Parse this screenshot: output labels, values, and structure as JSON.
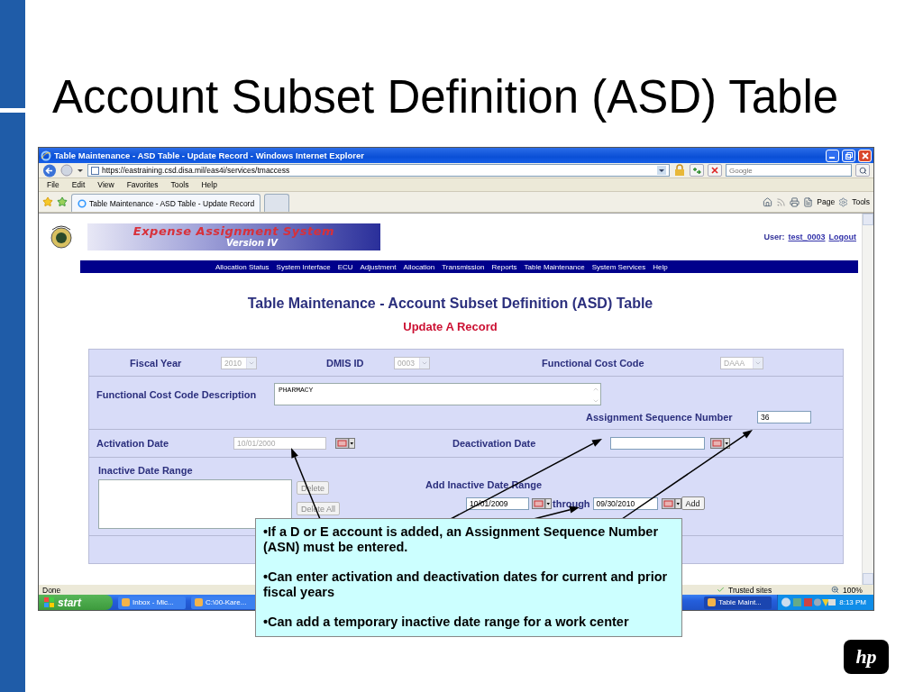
{
  "slide": {
    "title": "Account Subset Definition (ASD) Table",
    "logo": "hp"
  },
  "browser": {
    "title": "Table Maintenance - ASD Table - Update Record - Windows Internet Explorer",
    "address": "https://eastraining.csd.disa.mil/eas4i/services/tmaccess",
    "search_placeholder": "Google",
    "menu": [
      "File",
      "Edit",
      "View",
      "Favorites",
      "Tools",
      "Help"
    ],
    "tabs": [
      {
        "label": "Table Maintenance - ASD Table - Update Record",
        "selected": true
      }
    ],
    "commands": [
      "Page",
      "Tools"
    ]
  },
  "page": {
    "banner": {
      "title": "Expense Assignment System",
      "subtitle": "Version IV"
    },
    "user_label": "User:",
    "user": "test_0003",
    "logout": "Logout",
    "nav": [
      "Allocation Status",
      "System Interface",
      "ECU",
      "Adjustment",
      "Allocation",
      "Transmission",
      "Reports",
      "Table Maintenance",
      "System Services",
      "Help"
    ],
    "heading": "Table Maintenance - Account Subset Definition (ASD) Table",
    "subheading": "Update A Record",
    "form": {
      "fiscal_year": {
        "label": "Fiscal Year",
        "value": "2010",
        "disabled": true
      },
      "dmis_id": {
        "label": "DMIS ID",
        "value": "0003",
        "disabled": true
      },
      "functional_cost_code": {
        "label": "Functional Cost Code",
        "value": "DAAA",
        "disabled": true
      },
      "description": {
        "label": "Functional Cost Code Description",
        "value": "PHARMACY"
      },
      "asn": {
        "label": "Assignment Sequence Number",
        "value": "36"
      },
      "activation_date": {
        "label": "Activation Date",
        "value": "10/01/2000",
        "disabled": true
      },
      "deactivation_date": {
        "label": "Deactivation Date"
      },
      "inactive_range": {
        "label": "Inactive Date Range",
        "buttons": [
          {
            "label": "Delete",
            "disabled": true
          },
          {
            "label": "Delete All",
            "disabled": true
          }
        ]
      },
      "add_range": {
        "label": "Add Inactive Date Range",
        "from": "10/01/2009",
        "through": "through",
        "to": "09/30/2010",
        "button": {
          "label": "Add",
          "disabled": false
        }
      }
    }
  },
  "status_bar": {
    "text": "Done",
    "zone": "Trusted sites",
    "zoom": "100%"
  },
  "taskbar": {
    "start": "start",
    "items": [
      {
        "label": "Inbox - Mic...",
        "selected": false
      },
      {
        "label": "C:\\00-Kare...",
        "selected": false
      },
      {
        "label": "Table Maint...",
        "selected": true
      }
    ],
    "clock": "8:13 PM"
  },
  "callout": {
    "bullets": [
      "•If a D or E account is added, an Assignment Sequence Number (ASN) must be entered.",
      "•Can enter activation and deactivation dates for current and prior fiscal years",
      "•Can add a temporary inactive date range for a work center"
    ]
  }
}
